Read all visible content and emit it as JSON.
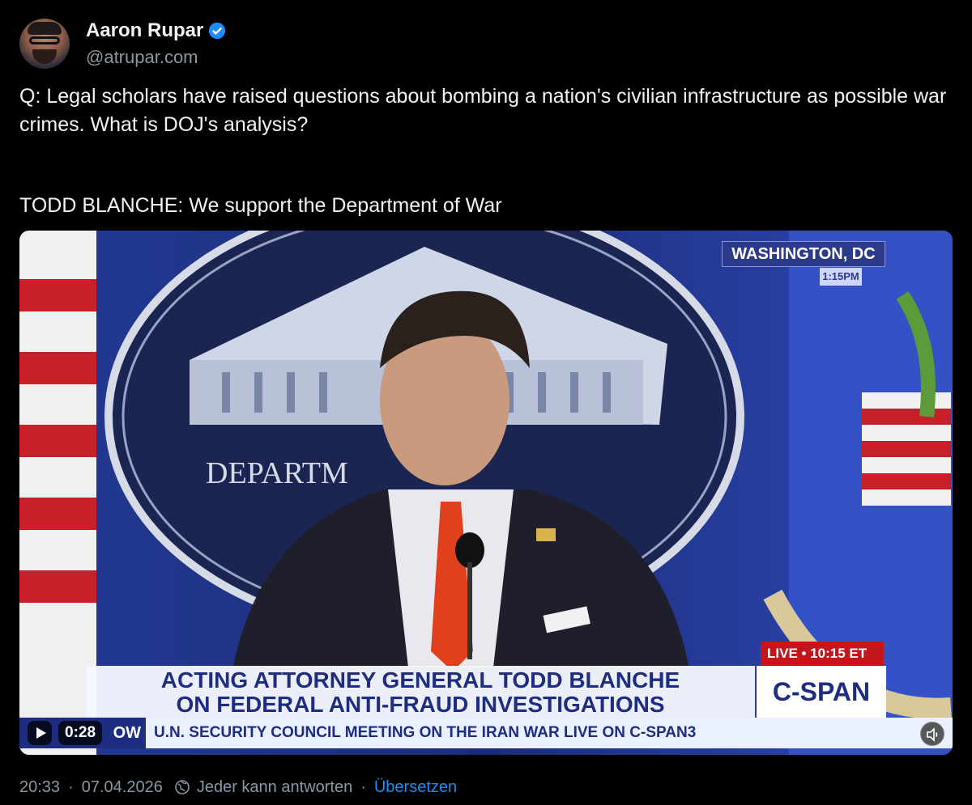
{
  "author": {
    "display_name": "Aaron Rupar",
    "handle": "@atrupar.com",
    "verified_icon": "verified-badge-icon",
    "avatar_icon": "avatar-photo"
  },
  "post": {
    "question": "Q: Legal scholars have raised questions about bombing a nation's civilian infrastructure as possible war crimes. What is DOJ's analysis?",
    "answer": "TODD BLANCHE: We support the Department of War"
  },
  "video": {
    "location": "WASHINGTON, DC",
    "time_small": "1:15PM",
    "live_label": "LIVE • 10:15 ET",
    "headline_line1": "ACTING ATTORNEY GENERAL TODD BLANCHE",
    "headline_line2": "ON FEDERAL ANTI-FRAUD INVESTIGATIONS",
    "network": "C-SPAN",
    "ticker_tag": "OW",
    "ticker_text": "U.N. SECURITY COUNCIL MEETING ON THE IRAN WAR  LIVE ON C-SPAN3",
    "backdrop_text": "DEPARTM",
    "duration": "0:28",
    "play_icon": "play-icon",
    "mute_icon": "speaker-icon"
  },
  "footer": {
    "time": "20:33",
    "date": "07.04.2026",
    "reply_setting": "Jeder kann antworten",
    "translate": "Übersetzen",
    "separator": "·"
  },
  "colors": {
    "background": "#000000",
    "link": "#1d8cf7",
    "muted": "#8b98a5",
    "verified": "#1d8cf7"
  }
}
